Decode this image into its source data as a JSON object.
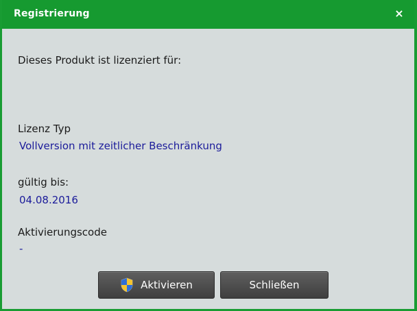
{
  "dialog": {
    "title": "Registrierung",
    "close_symbol": "×",
    "licensed_to_label": "Dieses Produkt ist lizenziert für:",
    "license_type_label": "Lizenz Typ",
    "license_type_value": "Vollversion mit zeitlicher Beschränkung",
    "valid_until_label": "gültig bis:",
    "valid_until_value": "04.08.2016",
    "activation_code_label": "Aktivierungscode",
    "activation_code_value": "-"
  },
  "buttons": {
    "activate_label": "Aktivieren",
    "activate_icon": "uac-shield-icon",
    "close_label": "Schließen"
  },
  "colors": {
    "title_bar": "#169a30",
    "background": "#d6dcdc",
    "value_text": "#1b1b9a"
  }
}
